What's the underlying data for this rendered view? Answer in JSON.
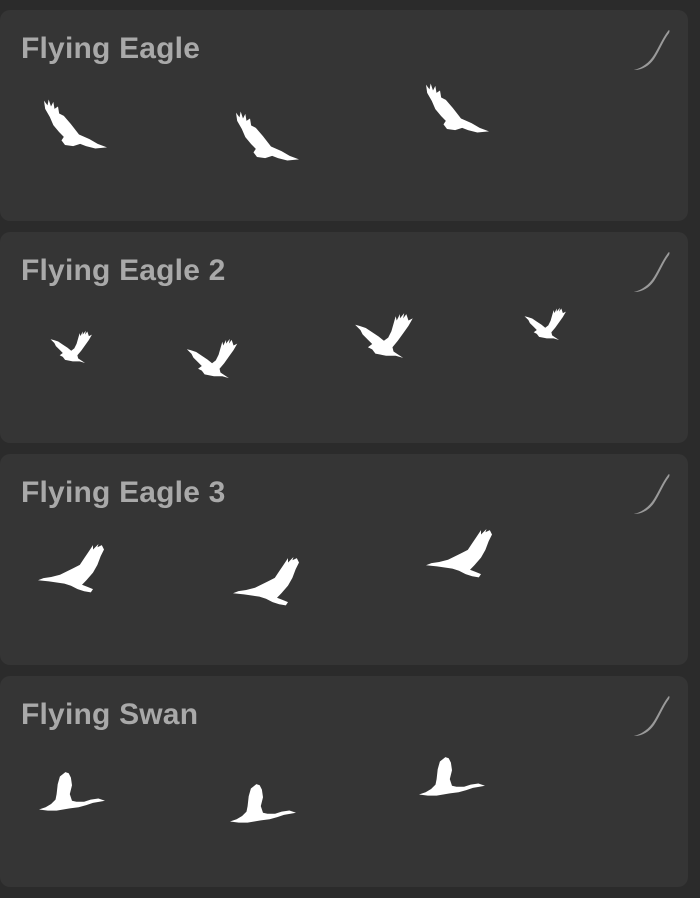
{
  "brushes": [
    {
      "title": "Flying Eagle",
      "preview_icon": "eagle-soaring-icon",
      "stroke_icon": "brush-stroke-icon"
    },
    {
      "title": "Flying Eagle 2",
      "preview_icon": "eagle-rising-icon",
      "stroke_icon": "brush-stroke-icon"
    },
    {
      "title": "Flying Eagle 3",
      "preview_icon": "eagle-gliding-icon",
      "stroke_icon": "brush-stroke-icon"
    },
    {
      "title": "Flying Swan",
      "preview_icon": "swan-flying-icon",
      "stroke_icon": "brush-stroke-icon"
    }
  ],
  "colors": {
    "background": "#2b2b2b",
    "card": "#353535",
    "title": "#a9a9a9",
    "silhouette": "#ffffff",
    "stroke_icon": "#9a9a9a"
  }
}
